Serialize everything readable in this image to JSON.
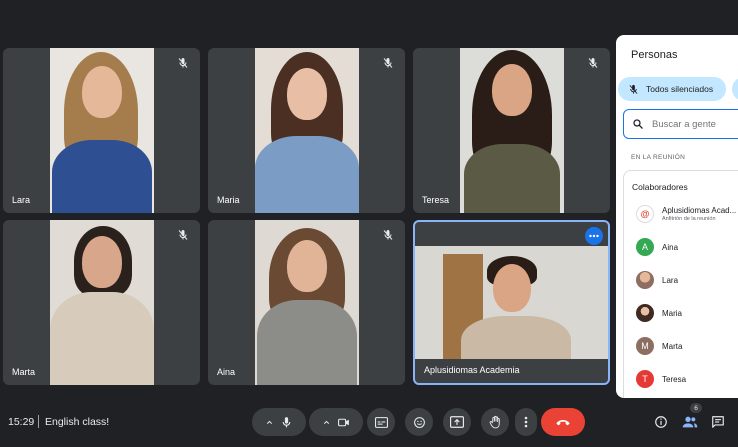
{
  "participants": [
    {
      "name": "Lara",
      "muted": true
    },
    {
      "name": "Maria",
      "muted": true
    },
    {
      "name": "Teresa",
      "muted": true
    },
    {
      "name": "Marta",
      "muted": true
    },
    {
      "name": "Aina",
      "muted": true
    },
    {
      "name": "Aplusidiomas Academia",
      "muted": false,
      "active": true
    }
  ],
  "panel": {
    "title": "Personas",
    "mute_all_label": "Todos silenciados",
    "search_placeholder": "Buscar a gente",
    "section_label": "EN LA REUNIÓN",
    "collaborators_label": "Colaboradores",
    "people": [
      {
        "name": "Aplusidiomas Acad...",
        "sub": "Anfitrión de la reunión",
        "avatar_letter": "@",
        "avatar_color": "#ffffff"
      },
      {
        "name": "Aina",
        "avatar_letter": "A",
        "avatar_color": "#34a853"
      },
      {
        "name": "Lara",
        "avatar_letter": "",
        "avatar_color": "#8d6e63"
      },
      {
        "name": "Maria",
        "avatar_letter": "",
        "avatar_color": "#5d4037"
      },
      {
        "name": "Marta",
        "avatar_letter": "M",
        "avatar_color": "#8d6e63"
      },
      {
        "name": "Teresa",
        "avatar_letter": "T",
        "avatar_color": "#e53935"
      }
    ]
  },
  "bottom": {
    "time": "15:29",
    "meeting_title": "English class!",
    "people_count": "6"
  },
  "colors": {
    "accent": "#1a73e8",
    "end_call": "#ea4335",
    "background": "#202124",
    "tile": "#3c4043"
  }
}
